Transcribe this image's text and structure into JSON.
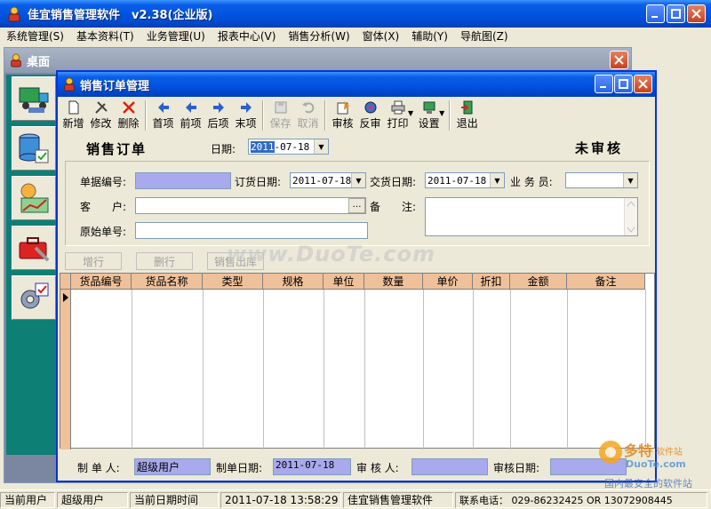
{
  "app": {
    "title": "佳宜销售管理软件　v2.38(企业版)"
  },
  "menu": [
    "系统管理(S)",
    "基本资料(T)",
    "业务管理(U)",
    "报表中心(V)",
    "销售分析(W)",
    "窗体(X)",
    "辅助(Y)",
    "导航图(Z)"
  ],
  "desktop": {
    "title": "桌面"
  },
  "order_window": {
    "title": "销售订单管理",
    "toolbar": [
      {
        "label": "新增",
        "icon": "new-doc-icon",
        "enabled": true
      },
      {
        "label": "修改",
        "icon": "edit-tools-icon",
        "enabled": true
      },
      {
        "label": "删除",
        "icon": "delete-x-icon",
        "enabled": true
      },
      {
        "label": "首项",
        "icon": "first-arrow-icon",
        "enabled": true
      },
      {
        "label": "前项",
        "icon": "prev-arrow-icon",
        "enabled": true
      },
      {
        "label": "后项",
        "icon": "next-arrow-icon",
        "enabled": true
      },
      {
        "label": "末项",
        "icon": "last-arrow-icon",
        "enabled": true
      },
      {
        "label": "保存",
        "icon": "save-icon",
        "enabled": false
      },
      {
        "label": "取消",
        "icon": "undo-icon",
        "enabled": false
      },
      {
        "label": "审核",
        "icon": "approve-icon",
        "enabled": true
      },
      {
        "label": "反审",
        "icon": "unapprove-icon",
        "enabled": true
      },
      {
        "label": "打印",
        "icon": "printer-icon",
        "enabled": true
      },
      {
        "label": "设置",
        "icon": "settings-monitor-icon",
        "enabled": true
      },
      {
        "label": "退出",
        "icon": "exit-door-icon",
        "enabled": true
      }
    ],
    "doc_title": "销售订单",
    "date_label": "日期:",
    "date_value": "2011-07-18",
    "date_year_highlight": "2011",
    "date_rest": "-07-18",
    "status": "未审核",
    "fields": {
      "doc_no_label": "单据编号:",
      "order_date_label": "订货日期:",
      "order_date_value": "2011-07-18",
      "delivery_date_label": "交货日期:",
      "delivery_date_value": "2011-07-18",
      "salesman_label": "业 务 员:",
      "customer_label": "客　　户:",
      "customer_btn": "…",
      "remark_label": "备　　注:",
      "orig_no_label": "原始单号:"
    },
    "grid_buttons": [
      "增行",
      "删行",
      "销售出库"
    ],
    "grid_columns": [
      "货品编号",
      "货品名称",
      "类型",
      "规格",
      "单位",
      "数量",
      "单价",
      "折扣",
      "金额",
      "备注"
    ],
    "footer": {
      "maker_label": "制 单 人:",
      "maker_value": "超级用户",
      "make_date_label": "制单日期:",
      "make_date_value": "2011-07-18",
      "auditor_label": "审 核 人:",
      "audit_date_label": "审核日期:"
    }
  },
  "statusbar": [
    "当前用户",
    "超级用户",
    "当前日期时间",
    "2011-07-18 13:58:29",
    "佳宜销售管理软件",
    "联系电话： 029-86232425  OR  13072908445"
  ],
  "watermark": "www.DuoTe.com",
  "corner_logo": {
    "brand": "多特",
    "sub": "软件站",
    "url": "DuoTe.com",
    "slogan": "国内最安全的软件站"
  },
  "colors": {
    "titlebar_blue": "#0054e3",
    "grid_header": "#efc19a",
    "purple_field": "#a9a9ee",
    "sidebar_teal": "#0e7f74"
  }
}
